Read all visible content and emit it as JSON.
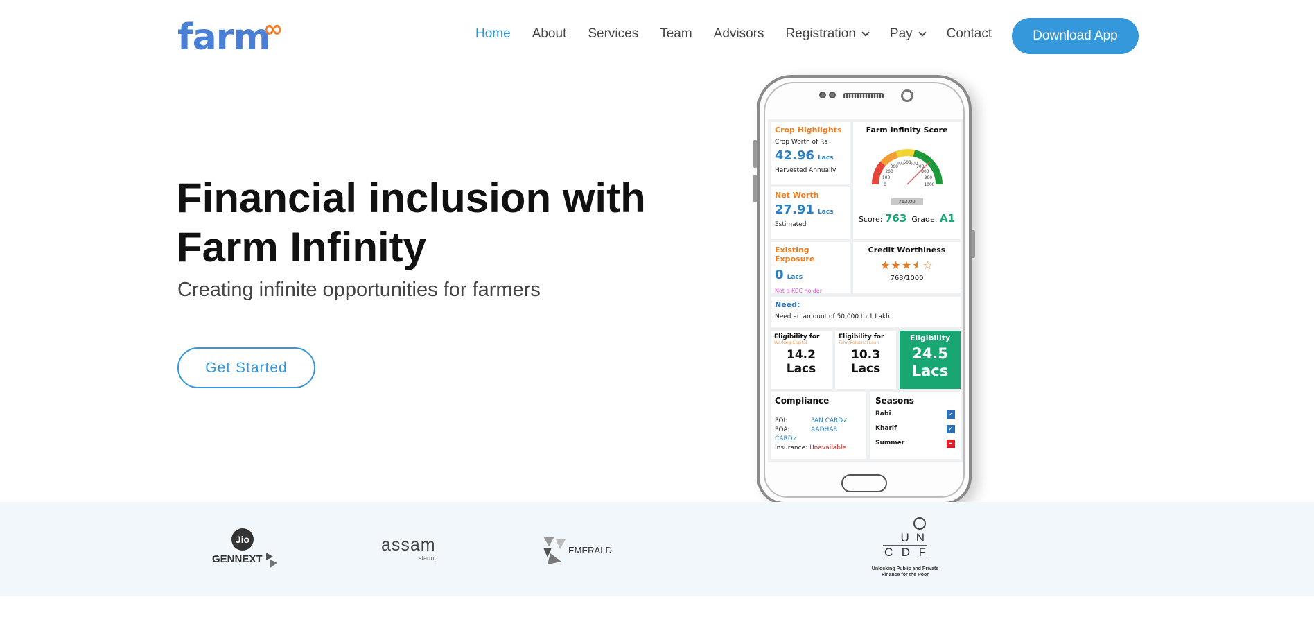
{
  "header": {
    "logo_text": "farm",
    "logo_symbol": "∞",
    "nav": [
      {
        "label": "Home",
        "active": true,
        "dropdown": false
      },
      {
        "label": "About",
        "active": false,
        "dropdown": false
      },
      {
        "label": "Services",
        "active": false,
        "dropdown": false
      },
      {
        "label": "Team",
        "active": false,
        "dropdown": false
      },
      {
        "label": "Advisors",
        "active": false,
        "dropdown": false
      },
      {
        "label": "Registration",
        "active": false,
        "dropdown": true
      },
      {
        "label": "Pay",
        "active": false,
        "dropdown": true
      },
      {
        "label": "Contact",
        "active": false,
        "dropdown": false
      }
    ],
    "download_label": "Download App"
  },
  "hero": {
    "title_line1": "Financial inclusion with",
    "title_line2": "Farm Infinity",
    "subtitle": "Creating infinite opportunities for farmers",
    "cta_label": "Get Started"
  },
  "phone_screen": {
    "crop": {
      "title": "Crop Highlights",
      "label": "Crop Worth of Rs",
      "value": "42.96",
      "unit": "Lacs",
      "note": "Harvested Annually"
    },
    "networth": {
      "title": "Net Worth",
      "value": "27.91",
      "unit": "Lacs",
      "note": "Estimated"
    },
    "score": {
      "title": "Farm Infinity Score",
      "gauge_ticks": [
        "0",
        "100",
        "200",
        "300",
        "400",
        "500",
        "600",
        "700",
        "800",
        "900",
        "1000"
      ],
      "readout": "763.00",
      "score_label": "Score:",
      "score_value": "763",
      "grade_label": "Grade:",
      "grade_value": "A1"
    },
    "exposure": {
      "title": "Existing Exposure",
      "value": "0",
      "unit": "Lacs",
      "note": "Not a KCC holder"
    },
    "credit": {
      "title": "Credit Worthiness",
      "stars": 3.5,
      "stars_max": 5,
      "ratio": "763/1000"
    },
    "need": {
      "title": "Need:",
      "text": "Need an amount of 50,000 to 1 Lakh."
    },
    "elig1": {
      "title": "Eligibility for",
      "sub": "Working Capital",
      "value": "14.2",
      "unit": "Lacs"
    },
    "elig2": {
      "title": "Eligibility for",
      "sub": "Term/Personal Loan",
      "value": "10.3",
      "unit": "Lacs"
    },
    "elig3": {
      "title": "Eligibility",
      "value": "24.5",
      "unit": "Lacs"
    },
    "compliance": {
      "title": "Compliance",
      "rows": [
        {
          "label": "POI:",
          "value": "PAN CARD",
          "ok": true
        },
        {
          "label": "POA:",
          "value": "AADHAR CARD",
          "ok": true
        },
        {
          "label": "Insurance:",
          "value": "Unavailable",
          "ok": false
        }
      ]
    },
    "seasons": {
      "title": "Seasons",
      "rows": [
        {
          "label": "Rabi",
          "checked": true
        },
        {
          "label": "Kharif",
          "checked": true
        },
        {
          "label": "Summer",
          "checked": false
        }
      ]
    }
  },
  "partners": {
    "jio_top": "Jio",
    "jio_bottom": "GENNEXT",
    "assam_main": "assam",
    "assam_sub": "startup",
    "emerald": "EMERALD",
    "uncdf_letters": [
      "U",
      "N",
      "C",
      "D",
      "F"
    ],
    "uncdf_tagline1": "Unlocking Public and Private",
    "uncdf_tagline2": "Finance for the Poor"
  },
  "colors": {
    "accent": "#3498db",
    "logo_blue": "#4a7fd6",
    "logo_orange": "#f07b2a",
    "strip_bg": "#f2f7fb",
    "elig_green": "#18a673"
  }
}
